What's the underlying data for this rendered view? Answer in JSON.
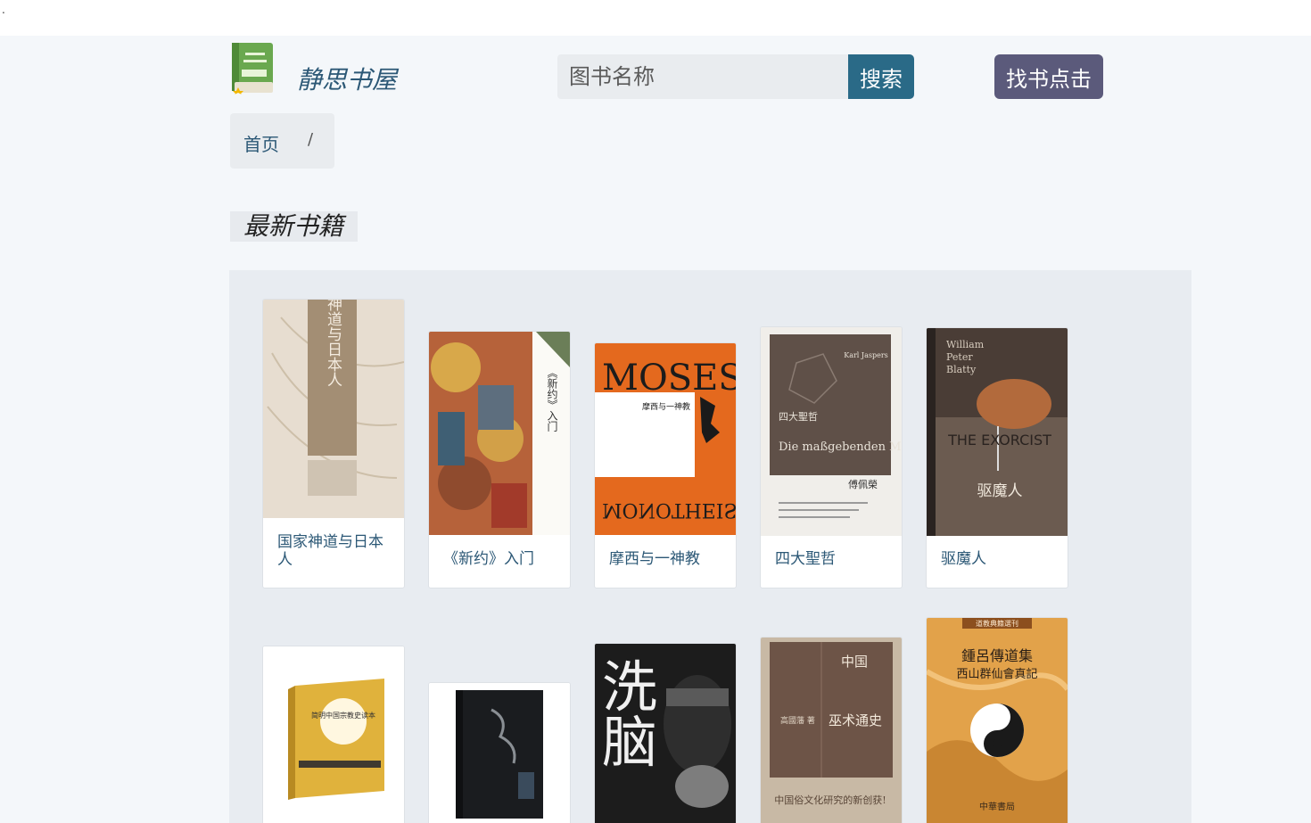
{
  "site": {
    "title": "静思书屋",
    "corner_text": "."
  },
  "search": {
    "placeholder": "图书名称",
    "button_label": "搜索"
  },
  "find_button_label": "找书点击",
  "breadcrumb": {
    "home": "首页",
    "separator": "/"
  },
  "section_title": "最新书籍",
  "books": [
    {
      "title": "国家神道与日本人"
    },
    {
      "title": "《新约》入门"
    },
    {
      "title": "摩西与一神教"
    },
    {
      "title": "四大聖哲"
    },
    {
      "title": "驱魔人"
    },
    {
      "title": "简明中国宗教史读本"
    },
    {
      "title": ""
    },
    {
      "title": "洗脑"
    },
    {
      "title": "中国巫术通史"
    },
    {
      "title": "鍾呂傳道集 西山群仙會真記"
    }
  ],
  "covers": {
    "book1": {
      "vertical_title": "国家神道与日本人"
    },
    "book2": {
      "vertical_title": "《新约》入门"
    },
    "book3": {
      "big": "MOSES",
      "sub": "摩西与一神教",
      "mirrored": "MONOTHEIS"
    },
    "book4": {
      "author": "Karl Jaspers",
      "cn": "四大聖哲",
      "de": "Die maßgebenden Menschen",
      "translator": "傅佩榮"
    },
    "book5": {
      "author_line1": "William",
      "author_line2": "Peter",
      "author_line3": "Blatty",
      "en": "THE EXORCIST",
      "cn": "驱魔人"
    },
    "book6": {
      "title": "简明中国宗教史读本"
    },
    "book8": {
      "big1": "洗",
      "big2": "脑"
    },
    "book9": {
      "line1": "中国",
      "line2": "巫术通史",
      "author": "高國藩 著",
      "tag": "中国俗文化研究的新创获!"
    },
    "book10": {
      "series": "道教典籍選刊",
      "line1": "鍾呂傳道集",
      "line2": "西山群仙會真記",
      "publisher": "中華書局"
    }
  },
  "colors": {
    "link": "#2c5876",
    "search_button": "#2a6a87",
    "find_button": "#5b5a7b"
  }
}
